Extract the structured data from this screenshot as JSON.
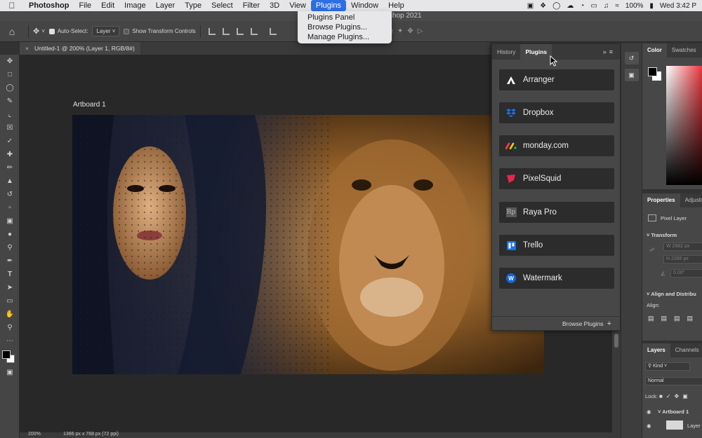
{
  "menubar": {
    "apple": "",
    "items": [
      "Photoshop",
      "File",
      "Edit",
      "Image",
      "Layer",
      "Type",
      "Select",
      "Filter",
      "3D",
      "View",
      "Plugins",
      "Window",
      "Help"
    ],
    "battery": "100%",
    "clock": "Wed 3:42 P"
  },
  "plugins_menu": {
    "items": [
      "Plugins Panel",
      "Browse Plugins...",
      "Manage Plugins..."
    ]
  },
  "window_title": "otoshop 2021",
  "options_bar": {
    "auto_select_label": "Auto-Select:",
    "auto_select_value": "Layer",
    "transform_label": "Show Transform Controls"
  },
  "document": {
    "tab_label": "Untitled-1 @ 200% (Layer 1, RGB/8#)",
    "artboard_label": "Artboard 1",
    "zoom": "200%",
    "doc_info": "1366 px x 768 px (72 ppi)"
  },
  "plugins_panel": {
    "tabs": [
      "History",
      "Plugins"
    ],
    "active_tab": "Plugins",
    "items": [
      {
        "name": "Arranger",
        "icon": "arranger-icon",
        "color": "#ffffff"
      },
      {
        "name": "Dropbox",
        "icon": "dropbox-icon",
        "color": "#1f6fe5"
      },
      {
        "name": "monday.com",
        "icon": "monday-icon",
        "color": "#ff3d57"
      },
      {
        "name": "PixelSquid",
        "icon": "pixelsquid-icon",
        "color": "#e8254e"
      },
      {
        "name": "Raya Pro",
        "icon": "raya-icon",
        "color": "#8a8a8a"
      },
      {
        "name": "Trello",
        "icon": "trello-icon",
        "color": "#1a73e8"
      },
      {
        "name": "Watermark",
        "icon": "watermark-icon",
        "color": "#1565d8"
      }
    ],
    "footer": "Browse Plugins"
  },
  "color_panel": {
    "tabs": [
      "Color",
      "Swatches"
    ]
  },
  "properties_panel": {
    "tabs": [
      "Properties",
      "Adjustm"
    ],
    "layer_type": "Pixel Layer",
    "transform_label": "Transform",
    "width": "W  2982 px",
    "height": "H  2266 px",
    "angle": "0.00°",
    "align_label": "Align and Distribu",
    "align_sub": "Align:"
  },
  "layers_panel": {
    "tabs": [
      "Layers",
      "Channels"
    ],
    "kind": "Kind",
    "blend": "Normal",
    "lock": "Lock:",
    "artboard": "Artboard 1",
    "layer": "Layer"
  }
}
